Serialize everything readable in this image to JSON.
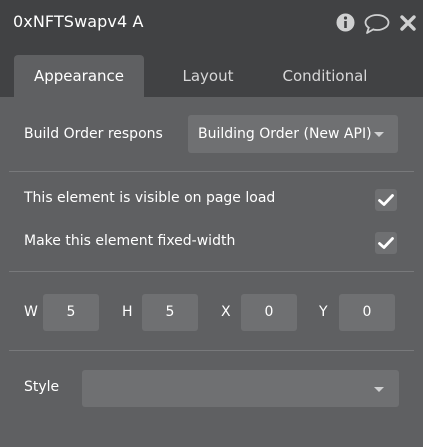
{
  "window": {
    "title": "0xNFTSwapv4 A",
    "icons": [
      "info-icon",
      "comment-icon",
      "close-icon"
    ]
  },
  "tabs": [
    {
      "label": "Appearance",
      "active": true
    },
    {
      "label": "Layout",
      "active": false
    },
    {
      "label": "Conditional",
      "active": false
    }
  ],
  "build_order": {
    "label": "Build Order respons",
    "value": "Building Order (New API)"
  },
  "visibility": {
    "visible_on_load_label": "This element is visible on page load",
    "visible_on_load_checked": true,
    "fixed_width_label": "Make this element fixed-width",
    "fixed_width_checked": true
  },
  "dimensions": {
    "w_label": "W",
    "w_value": "5",
    "h_label": "H",
    "h_value": "5",
    "x_label": "X",
    "x_value": "0",
    "y_label": "Y",
    "y_value": "0"
  },
  "style": {
    "label": "Style",
    "value": ""
  },
  "colors": {
    "panel_bg": "#5f6062",
    "header_bg": "#414244",
    "input_bg": "#6f7072"
  }
}
